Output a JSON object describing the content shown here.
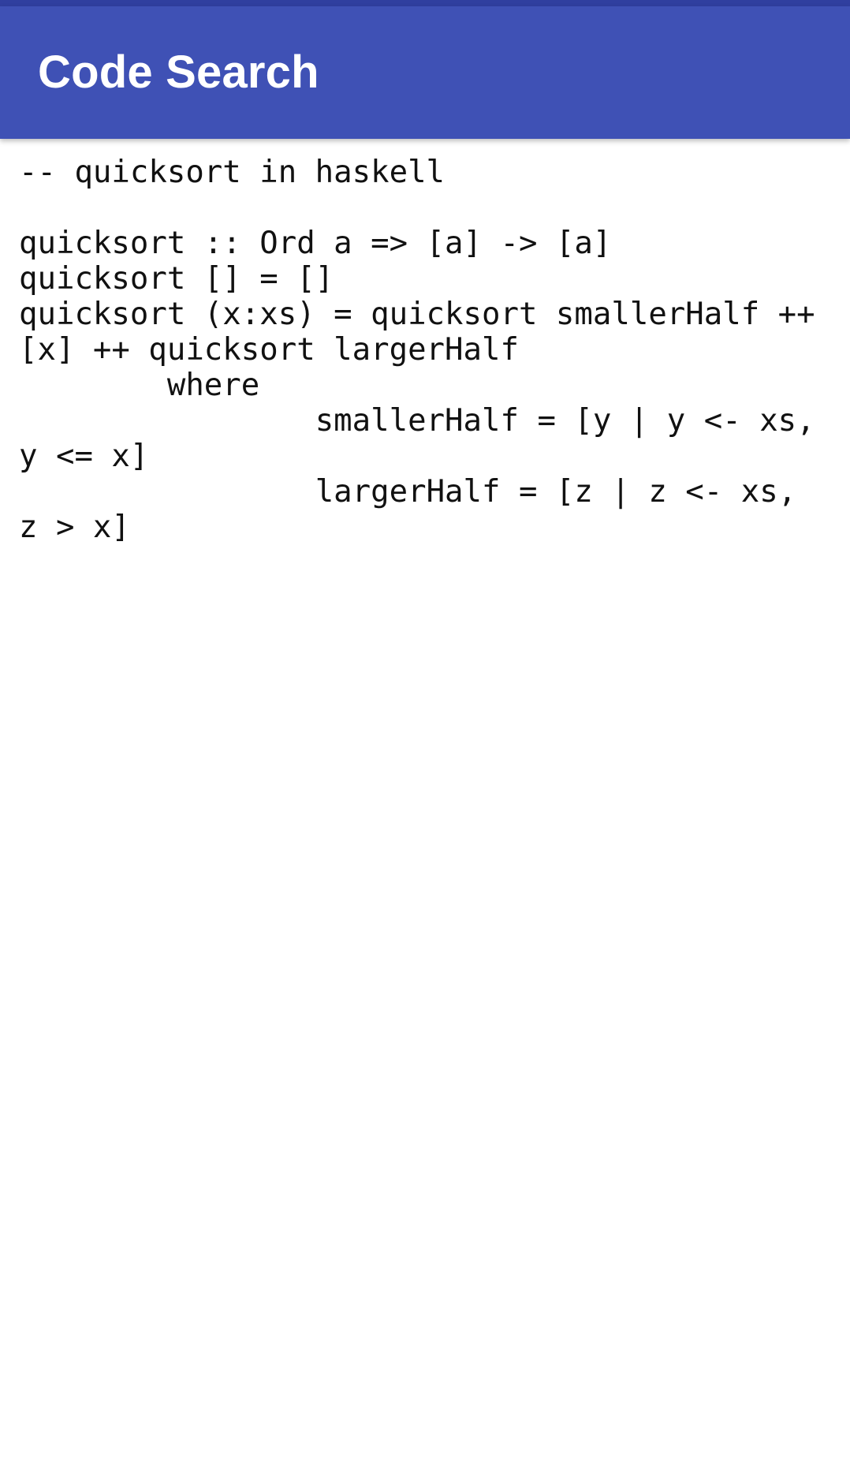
{
  "app_bar": {
    "title": "Code Search"
  },
  "colors": {
    "status_bar": "#303F9F",
    "app_bar": "#3F51B5",
    "title_text": "#FFFFFF",
    "code_text": "#111111",
    "background": "#FFFFFF"
  },
  "code": {
    "text": "-- quicksort in haskell\n\nquicksort :: Ord a => [a] -> [a]\nquicksort [] = []\nquicksort (x:xs) = quicksort smallerHalf ++ [x] ++ quicksort largerHalf\n        where\n                smallerHalf = [y | y <- xs, y <= x]\n                largerHalf = [z | z <- xs, z > x]"
  }
}
